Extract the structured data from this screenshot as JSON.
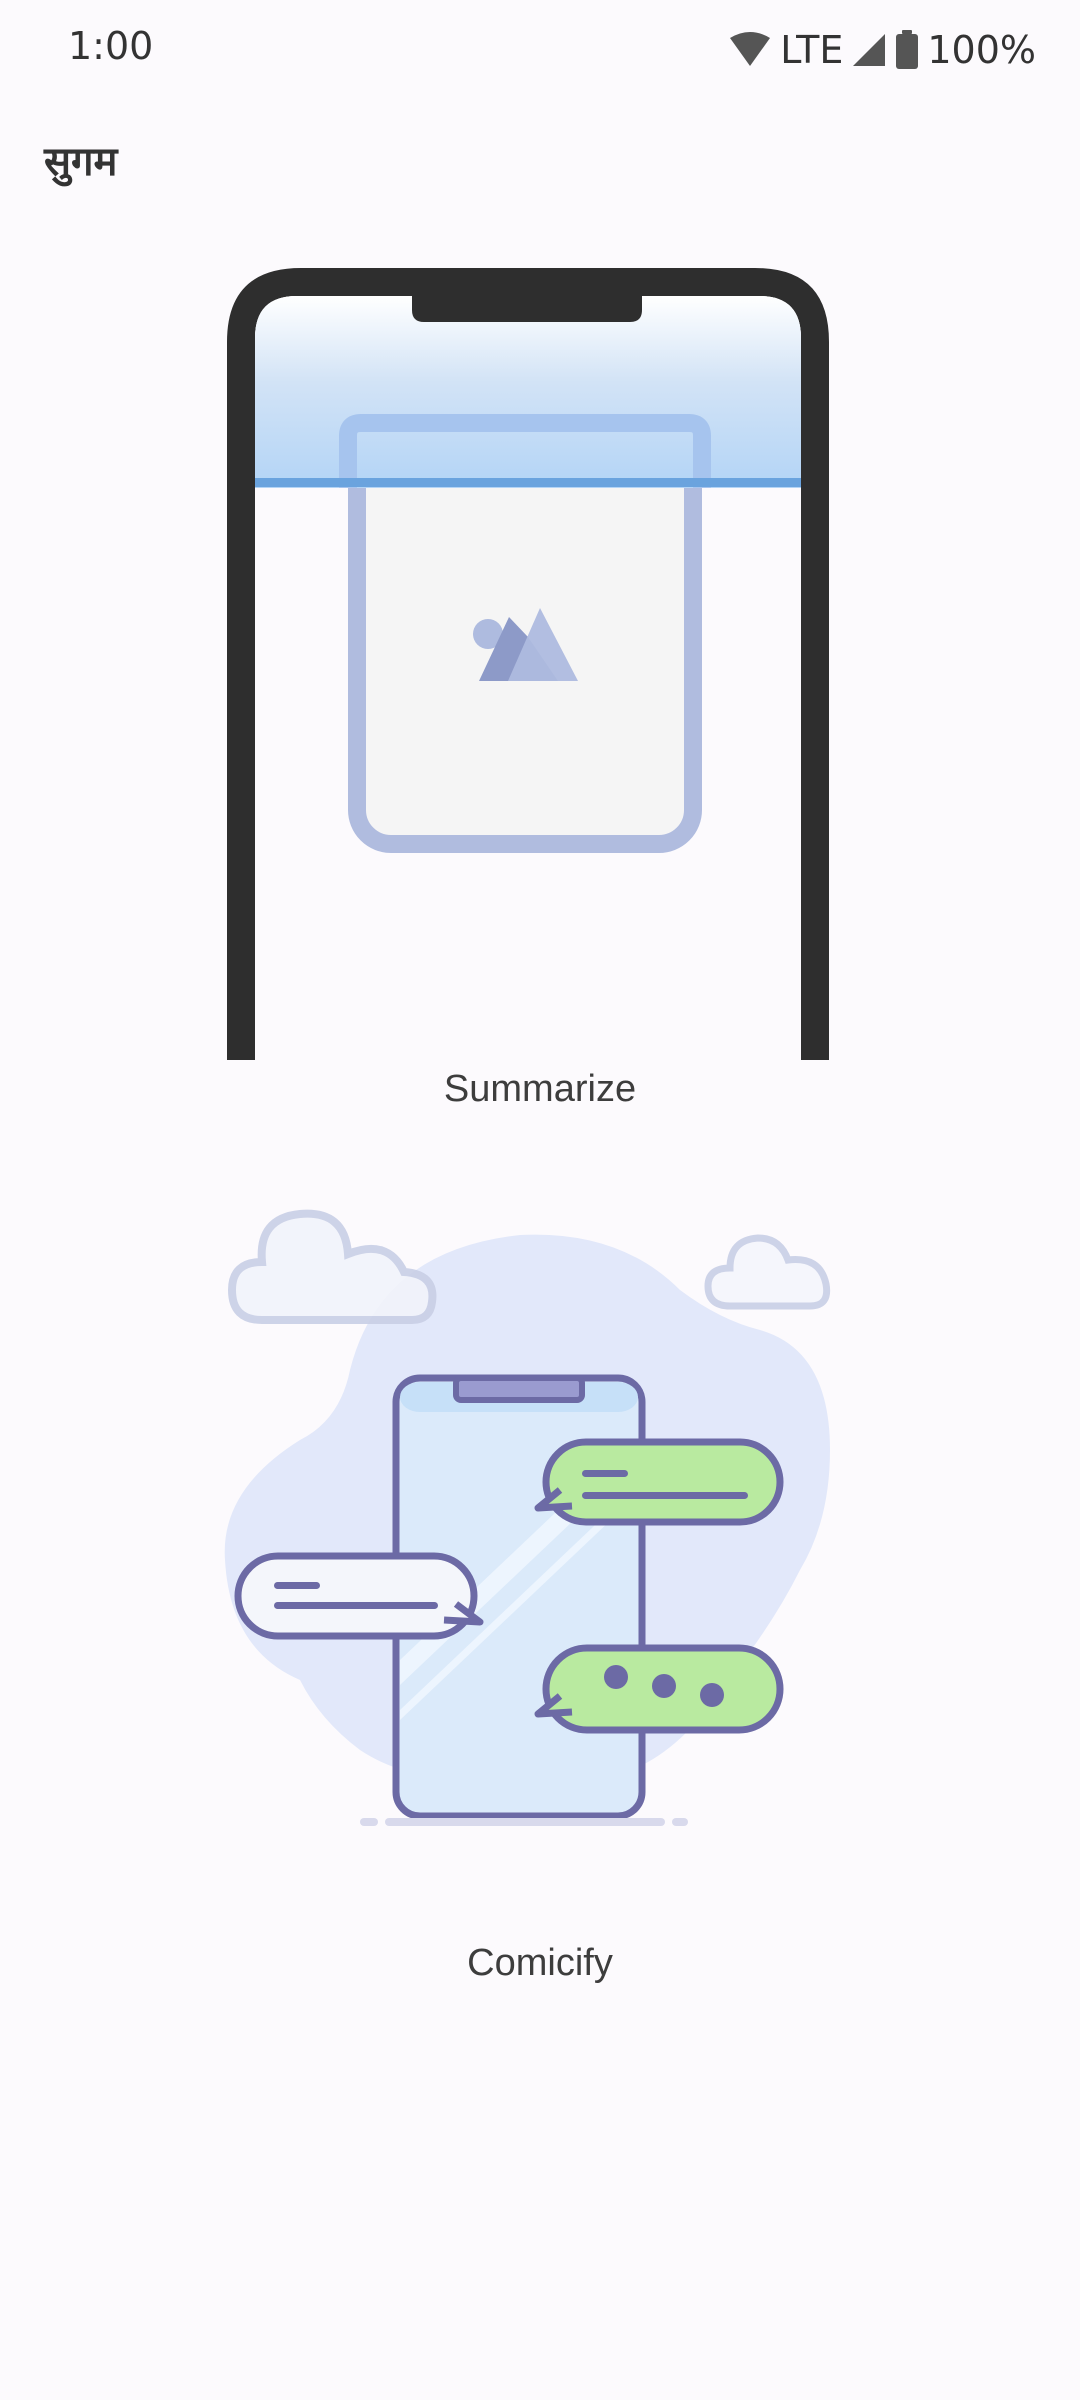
{
  "status_bar": {
    "time": "1:00",
    "network": "LTE",
    "battery": "100%"
  },
  "app": {
    "title": "सुगम"
  },
  "options": [
    {
      "label": "Summarize",
      "icon": "phone-scroll-illustration"
    },
    {
      "label": "Comicify",
      "icon": "phone-chat-illustration"
    }
  ]
}
